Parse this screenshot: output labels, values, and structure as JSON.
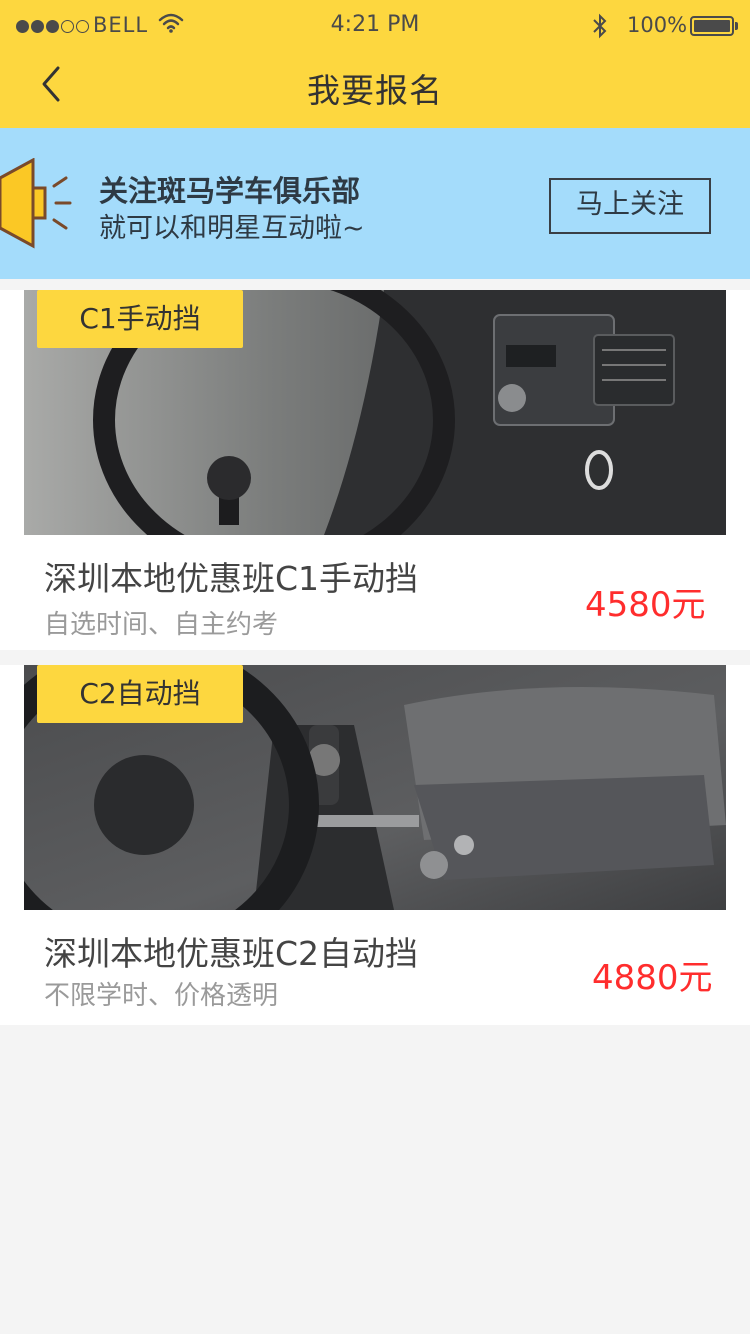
{
  "status_bar": {
    "carrier": "BELL",
    "time": "4:21 PM",
    "battery": "100%",
    "signal_dots": [
      true,
      true,
      true,
      false,
      false
    ]
  },
  "nav": {
    "title": "我要报名",
    "back_icon": "chevron-left-icon"
  },
  "banner": {
    "line1": "关注斑马学车俱乐部",
    "line2": "就可以和明星互动啦~",
    "button": "马上关注",
    "icon": "megaphone-icon"
  },
  "courses": [
    {
      "tag": "C1手动挡",
      "title": "深圳本地优惠班C1手动挡",
      "subtitle": "自选时间、自主约考",
      "price": "4580元"
    },
    {
      "tag": "C2自动挡",
      "title": "深圳本地优惠班C2自动挡",
      "subtitle": "不限学时、价格透明",
      "price": "4880元"
    }
  ],
  "colors": {
    "header_bg": "#fdd73f",
    "banner_bg": "#a4dcfb",
    "price": "#ff2d2d",
    "page_bg": "#f4f4f4"
  }
}
